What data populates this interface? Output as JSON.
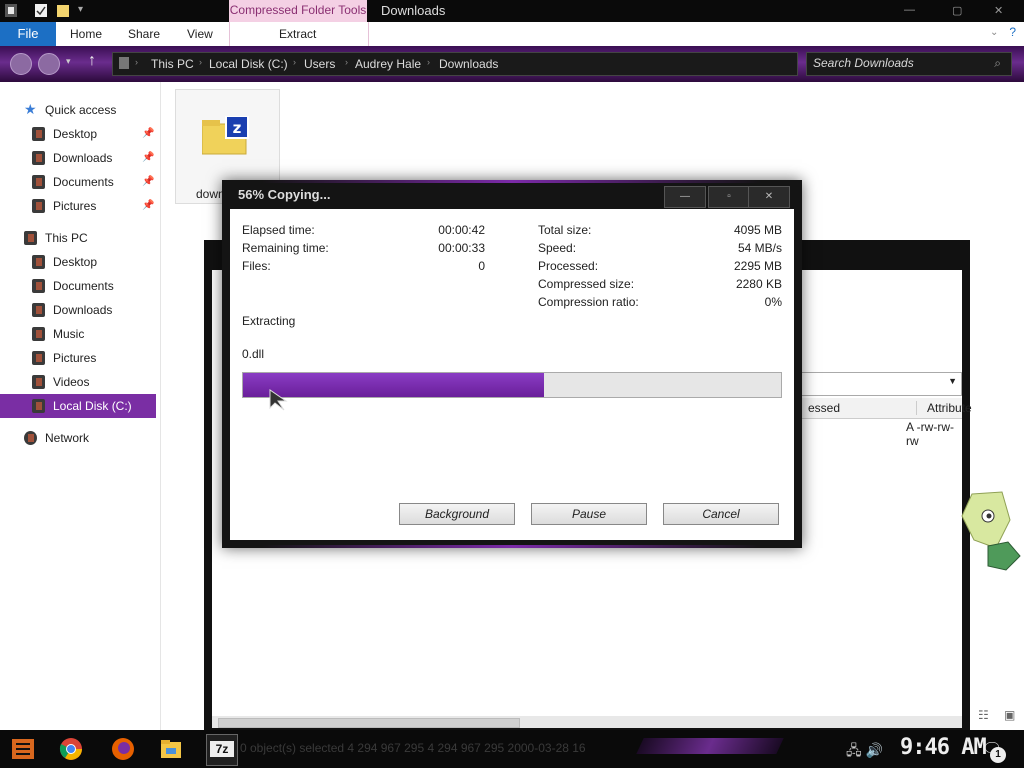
{
  "window": {
    "context_tab": "Compressed Folder Tools",
    "title": "Downloads"
  },
  "ribbon": {
    "file": "File",
    "home": "Home",
    "share": "Share",
    "view": "View",
    "extract": "Extract"
  },
  "address": {
    "crumbs": [
      "This PC",
      "Local Disk (C:)",
      "Users",
      "Audrey Hale",
      "Downloads"
    ],
    "search_placeholder": "Search Downloads"
  },
  "nav": {
    "quick_access": "Quick access",
    "qa_items": [
      "Desktop",
      "Downloads",
      "Documents",
      "Pictures"
    ],
    "this_pc": "This PC",
    "pc_items": [
      "Desktop",
      "Documents",
      "Downloads",
      "Music",
      "Pictures",
      "Videos",
      "Local Disk (C:)"
    ],
    "network": "Network"
  },
  "content": {
    "file_label": "down"
  },
  "background_window": {
    "col_compressed": "essed",
    "col_attributes": "Attribute",
    "attr_value": "A -rw-rw-rw"
  },
  "dialog": {
    "title": "56% Copying...",
    "percent": 56,
    "left": [
      {
        "label": "Elapsed time:",
        "value": "00:00:42"
      },
      {
        "label": "Remaining time:",
        "value": "00:00:33"
      },
      {
        "label": "Files:",
        "value": "0"
      }
    ],
    "right": [
      {
        "label": "Total size:",
        "value": "4095 MB"
      },
      {
        "label": "Speed:",
        "value": "54 MB/s"
      },
      {
        "label": "Processed:",
        "value": "2295 MB"
      },
      {
        "label": "Compressed size:",
        "value": "2280 KB"
      },
      {
        "label": "Compression ratio:",
        "value": "0%"
      }
    ],
    "operation": "Extracting",
    "current_file": "0.dll",
    "buttons": {
      "background": "Background",
      "pause": "Pause",
      "cancel": "Cancel"
    }
  },
  "taskbar": {
    "status_ghost": "0 object(s) selected        4 294 967 295     4 294 967 295     2000-03-28 16",
    "clock": "9:46 AM",
    "notifications": "1"
  },
  "colors": {
    "accent": "#7a2ea4",
    "file_tab": "#1c6fc4",
    "context_tab_bg": "#f4d0e4"
  },
  "icons": {
    "quick_access": "star-icon",
    "this_pc": "computer-icon",
    "network": "network-icon",
    "zip": "zip-archive-icon"
  }
}
